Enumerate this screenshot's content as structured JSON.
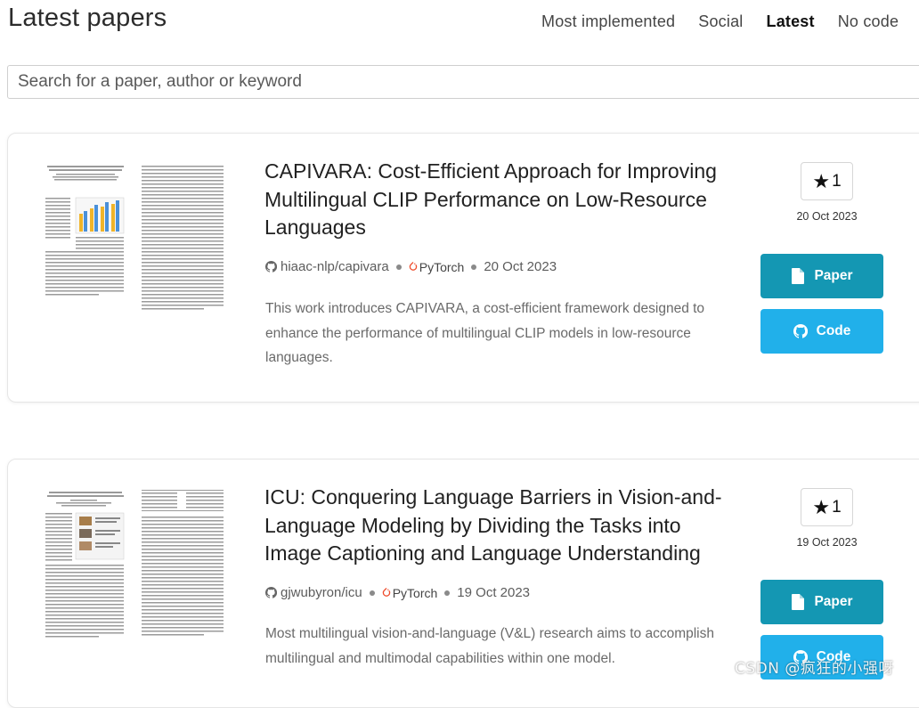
{
  "header": {
    "title": "Latest papers",
    "nav": [
      "Most implemented",
      "Social",
      "Latest",
      "No code"
    ],
    "active_nav": "Latest"
  },
  "search": {
    "placeholder": "Search for a paper, author or keyword",
    "value": ""
  },
  "papers": [
    {
      "title": "CAPIVARA: Cost-Efficient Approach for Improving Multilingual CLIP Performance on Low-Resource Languages",
      "repo": "hiaac-nlp/capivara",
      "framework": "PyTorch",
      "date": "20 Oct 2023",
      "abstract": "This work introduces CAPIVARA, a cost-efficient framework designed to enhance the performance of multilingual CLIP models in low-resource languages.",
      "stars": "1",
      "star_date": "20 Oct 2023",
      "paper_label": "Paper",
      "code_label": "Code"
    },
    {
      "title": "ICU: Conquering Language Barriers in Vision-and-Language Modeling by Dividing the Tasks into Image Captioning and Language Understanding",
      "repo": "gjwubyron/icu",
      "framework": "PyTorch",
      "date": "19 Oct 2023",
      "abstract": "Most multilingual vision-and-language (V&L) research aims to accomplish multilingual and multimodal capabilities within one model.",
      "stars": "1",
      "star_date": "19 Oct 2023",
      "paper_label": "Paper",
      "code_label": "Code"
    }
  ],
  "watermark": "CSDN @疯狂的小强呀",
  "colors": {
    "paper_button": "#1497b3",
    "code_button": "#21b0ea",
    "pytorch": "#ee4c2c"
  },
  "icons": [
    "star-icon",
    "github-icon",
    "pytorch-icon",
    "document-icon"
  ]
}
